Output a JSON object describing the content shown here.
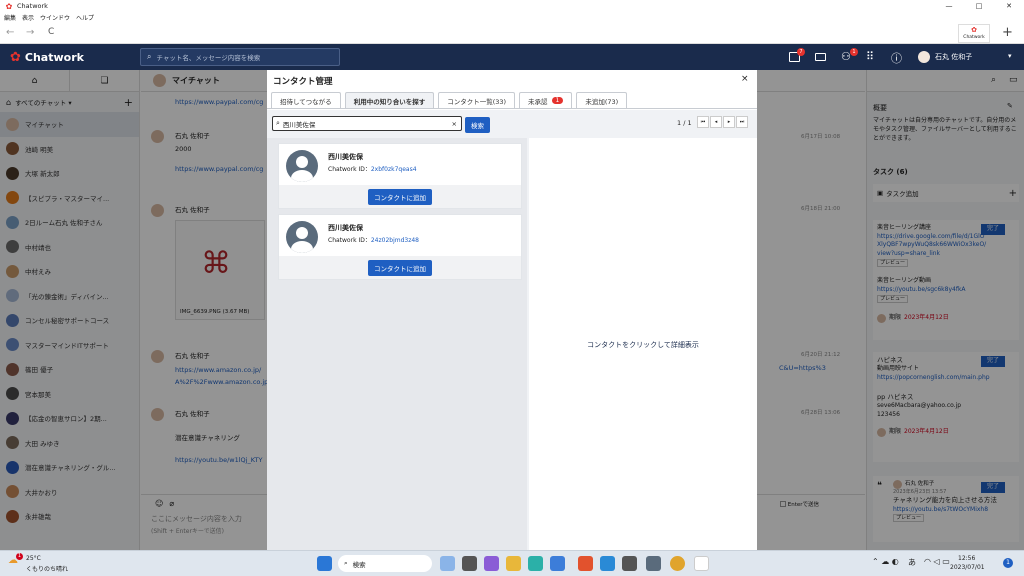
{
  "window": {
    "title": "Chatwork",
    "min": "—",
    "max": "□",
    "close": "✕"
  },
  "menu": [
    "編集",
    "表示",
    "ウインドウ",
    "ヘルプ"
  ],
  "browser": {
    "back": "←",
    "forward": "→",
    "reload": "C",
    "ext_label": "Chatwork",
    "add": "+"
  },
  "header": {
    "logo": "Chatwork",
    "search_placeholder": "チャット名、メッセージ内容を検索",
    "badge_tasks": "7",
    "badge_contacts": "1",
    "user_name": "石丸 佐和子",
    "info": "ⓘ",
    "caret": "▾"
  },
  "left": {
    "all_chats": "すべてのチャット ▾",
    "add": "+",
    "chats": [
      "マイチャット",
      "池崎 明美",
      "大塚 新太郎",
      "【スピプラ・マスターマイ...",
      "2日ルーム石丸 佐和子さん",
      "中村靖也",
      "中村えみ",
      "「光の錬金術」ディバイン...",
      "コンセル秘密サポートコース",
      "マスターマインドITサポート",
      "篠田 優子",
      "宮本那美",
      "【応金の智恵サロン】2期...",
      "大田 みゆき",
      "潜在意識チャネリング・グル...",
      "大井かおり",
      "永井雄哉"
    ]
  },
  "center": {
    "room_title": "マイチャット",
    "msg1_link": "https://www.paypal.com/cg",
    "msg2_name": "石丸 佐和子",
    "msg2_text": "2000",
    "msg2_link": "https://www.paypal.com/cg",
    "msg2_date": "6月17日 10:08",
    "msg3_name": "石丸 佐和子",
    "msg3_date": "6月18日 21:00",
    "file_name": "IMG_6639.PNG (3.67 MB)",
    "msg4_name": "石丸 佐和子",
    "msg4_date": "6月20日 21:12",
    "msg4_link1": "https://www.amazon.co.jp/",
    "msg4_link2": "A%2F%2Fwww.amazon.co.jp",
    "msg4_link_tail": "C&U=https%3",
    "msg5_name": "石丸 佐和子",
    "msg5_date": "6月28日 13:06",
    "msg5_text": "潜在意識チャネリング",
    "msg5_link": "https://youtu.be/w1lQj_KTY",
    "input_placeholder": "ここにメッセージ内容を入力",
    "input_hint": "(Shift + Enterキーで送信)",
    "enter_send": "Enterで送信"
  },
  "modal": {
    "title": "コンタクト管理",
    "close": "×",
    "tabs": [
      "招待してつながる",
      "利用中の知り合いを探す",
      "コンタクト一覧(33)",
      "未承認",
      "未追加(73)"
    ],
    "unapproved_badge": "1",
    "search_value": "西川美佐保",
    "search_clear": "×",
    "search_button": "検索",
    "pager": "1 / 1",
    "results": [
      {
        "name": "西川美佐保",
        "id_label": "Chatwork ID：",
        "id": "2xbf0zk7qeas4",
        "button": "コンタクトに追加"
      },
      {
        "name": "西川美佐保",
        "id_label": "Chatwork ID：",
        "id": "24z02bjmd3z48",
        "button": "コンタクトに追加"
      }
    ],
    "detail_placeholder": "コンタクトをクリックして詳細表示"
  },
  "right": {
    "overview_title": "概要",
    "overview_text": "マイチャットは自分専用のチャットです。自分用のメモやタスク管理、ファイルサーバーとして利用することができます。",
    "tasks_title": "タスク (6)",
    "add_task": "タスク追加",
    "done": "完了",
    "task1_title": "楽音ヒーリング講座",
    "task1_link": "https://drive.google.com/file/d/1GlOXlyQBF7wpyWuQ8sk66WWiOx3keO/view?usp=share_link",
    "preview": "プレビュー",
    "task2_title": "楽音ヒーリング動画",
    "task2_link": "https://youtu.be/sgc6k8y4fkA",
    "task2_assignee": "期限",
    "task2_date": "2023年4月12日",
    "task3_title": "ハピネス",
    "task3_sub": "動画用映サイト",
    "task3_link": "https://popcornenglish.com/main.php",
    "task3_pp": "pp ハピネス",
    "task3_email": "seve6Macbara@yahoo.co.jp",
    "task3_code": "123456",
    "task3_assignee": "期限",
    "task3_date": "2023年4月12日",
    "task4_user": "石丸 佐和子",
    "task4_date": "2023年6月23日 13:57",
    "task4_title": "チャネリング能力を向上させる方法",
    "task4_link": "https://youtu.be/s7tWOcYMixh8"
  },
  "taskbar": {
    "weather_temp": "25°C",
    "weather_text": "くもりのち晴れ",
    "weather_badge": "1",
    "search": "検索",
    "time": "12:56",
    "date": "2023/07/01",
    "ime": "あ",
    "notif": "1"
  }
}
